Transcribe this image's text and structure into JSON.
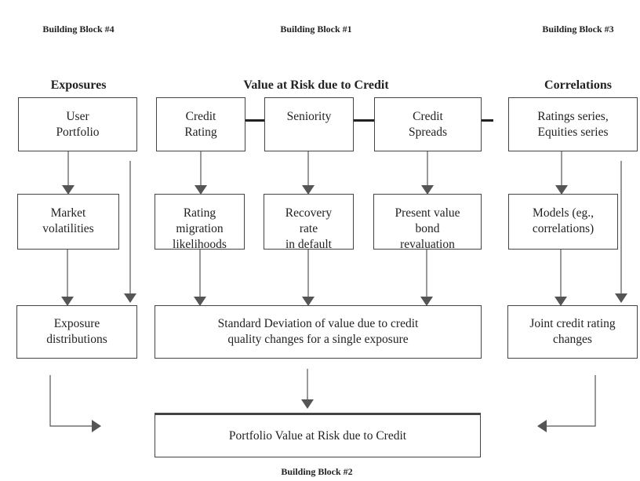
{
  "headers": {
    "block4": "Building Block  #4",
    "block1": "Building Block #1",
    "block3": "Building Block #3",
    "block2": "Building Block #2"
  },
  "titles": {
    "exposures": "Exposures",
    "var": "Value at Risk due to Credit",
    "correlations": "Correlations"
  },
  "boxes": {
    "user_portfolio": "User\nPortfolio",
    "credit_rating": "Credit\nRating",
    "seniority": "Seniority",
    "credit_spreads": "Credit\nSpreads",
    "ratings_series": "Ratings series,\nEquities series",
    "market_volatilities": "Market\nvolatilities",
    "rating_migration": "Rating\nmigration\nlikelihoods",
    "recovery_rate": "Recovery\nrate\nin default",
    "present_value": "Present value\nbond\nrevaluation",
    "models": "Models (eg.,\ncorrelations)",
    "exposure_distributions": "Exposure\ndistributions",
    "standard_deviation": "Standard Deviation of value due to credit\nquality changes for a single exposure",
    "joint_credit": "Joint credit rating\nchanges",
    "portfolio_var": "Portfolio Value at Risk due to Credit"
  },
  "colors": {
    "line": "#222222",
    "arrow": "#555555"
  }
}
